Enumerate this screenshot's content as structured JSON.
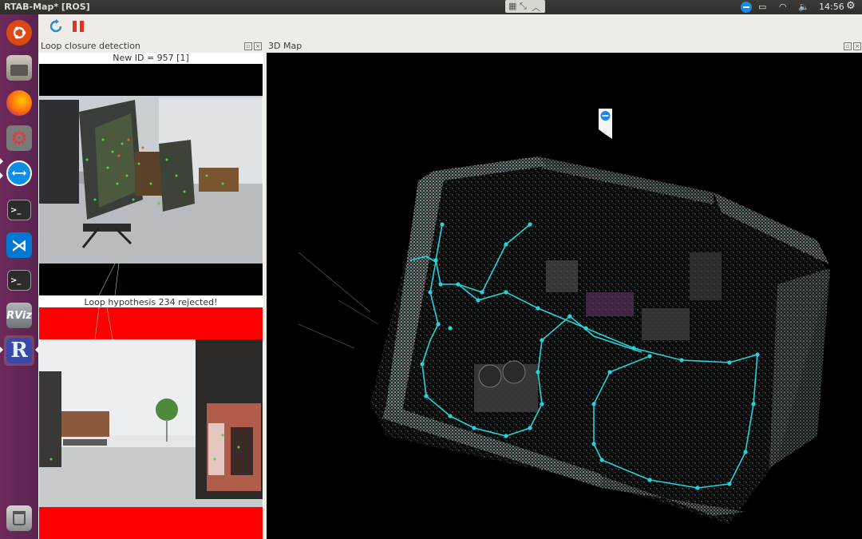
{
  "window": {
    "title": "RTAB-Map* [ROS]"
  },
  "system_tray": {
    "clock": "14:56"
  },
  "launcher": {
    "items": [
      {
        "name": "ubuntu",
        "label": "",
        "color": "#dd4814"
      },
      {
        "name": "files",
        "label": "",
        "color": "#a8a39a"
      },
      {
        "name": "firefox",
        "label": "",
        "color": "#e66000"
      },
      {
        "name": "settings",
        "label": "",
        "color": "#c0392b"
      },
      {
        "name": "teamviewer",
        "label": "",
        "color": "#0e8ee9"
      },
      {
        "name": "terminal",
        "label": "",
        "color": "#2c2c2c"
      },
      {
        "name": "vscode",
        "label": "",
        "color": "#0078d4"
      },
      {
        "name": "terminal-2",
        "label": "",
        "color": "#2c2c2c"
      },
      {
        "name": "rviz",
        "label": "RViz",
        "color": "#8a8f94"
      },
      {
        "name": "rtabmap",
        "label": "R",
        "color": "#3949ab"
      },
      {
        "name": "trash",
        "label": "",
        "color": "#8d8d8d"
      }
    ]
  },
  "panels": {
    "loop_closure": {
      "title": "Loop closure detection",
      "new_id_caption": "New ID = 957 [1]",
      "hypothesis_caption": "Loop hypothesis 234 rejected!"
    },
    "map3d": {
      "title": "3D Map"
    }
  },
  "colors": {
    "rejected": "#ff0000",
    "graph": "#27d3d8",
    "accent": "#d8e3ee"
  }
}
